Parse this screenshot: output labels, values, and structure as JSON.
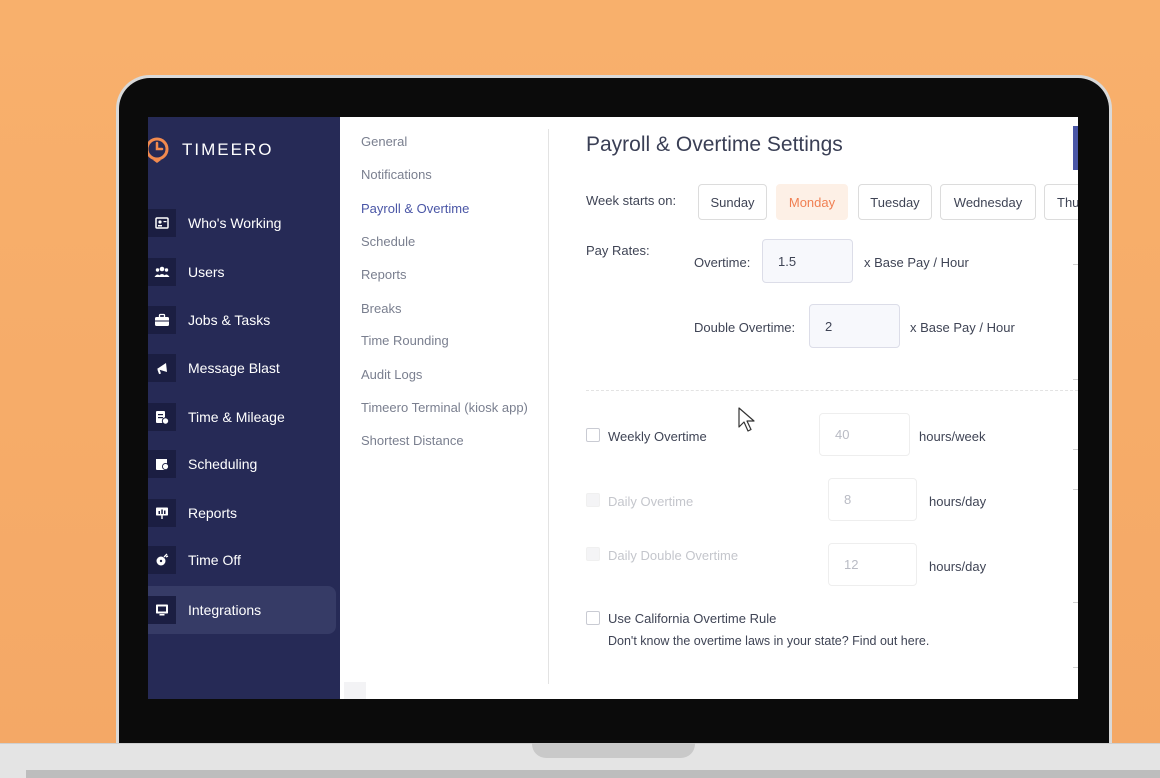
{
  "brand": {
    "name": "TIMEERO",
    "accent": "#4a56a6",
    "highlight": "#f07f52"
  },
  "sidebar": {
    "items": [
      {
        "label": "Who's Working",
        "icon": "id-card-icon"
      },
      {
        "label": "Users",
        "icon": "users-icon"
      },
      {
        "label": "Jobs & Tasks",
        "icon": "briefcase-icon"
      },
      {
        "label": "Message Blast",
        "icon": "megaphone-icon"
      },
      {
        "label": "Time & Mileage",
        "icon": "timesheet-icon"
      },
      {
        "label": "Scheduling",
        "icon": "calendar-clock-icon"
      },
      {
        "label": "Reports",
        "icon": "presentation-icon"
      },
      {
        "label": "Time Off",
        "icon": "time-off-icon"
      },
      {
        "label": "Integrations",
        "icon": "monitor-icon",
        "active": true
      }
    ]
  },
  "settings_nav": {
    "items": [
      "General",
      "Notifications",
      "Payroll & Overtime",
      "Schedule",
      "Reports",
      "Breaks",
      "Time Rounding",
      "Audit Logs",
      "Timeero Terminal (kiosk app)",
      "Shortest Distance"
    ],
    "active": "Payroll & Overtime"
  },
  "main": {
    "title": "Payroll & Overtime Settings",
    "week_label": "Week starts on:",
    "days": [
      "Sunday",
      "Monday",
      "Tuesday",
      "Wednesday",
      "Thu"
    ],
    "selected_day": "Monday",
    "pay_rates_label": "Pay Rates:",
    "overtime": {
      "label": "Overtime:",
      "value": "1.5",
      "suffix": "x Base Pay / Hour"
    },
    "double_overtime": {
      "label": "Double Overtime:",
      "value": "2",
      "suffix": "x Base Pay / Hour"
    },
    "weekly_overtime": {
      "label": "Weekly Overtime",
      "value": "40",
      "suffix": "hours/week",
      "checked": false
    },
    "daily_overtime": {
      "label": "Daily Overtime",
      "value": "8",
      "suffix": "hours/day",
      "disabled": true
    },
    "daily_double_overtime": {
      "label": "Daily Double Overtime",
      "value": "12",
      "suffix": "hours/day",
      "disabled": true
    },
    "california": {
      "label": "Use California Overtime Rule",
      "note": "Don't know the overtime laws in your state? Find out here."
    }
  }
}
